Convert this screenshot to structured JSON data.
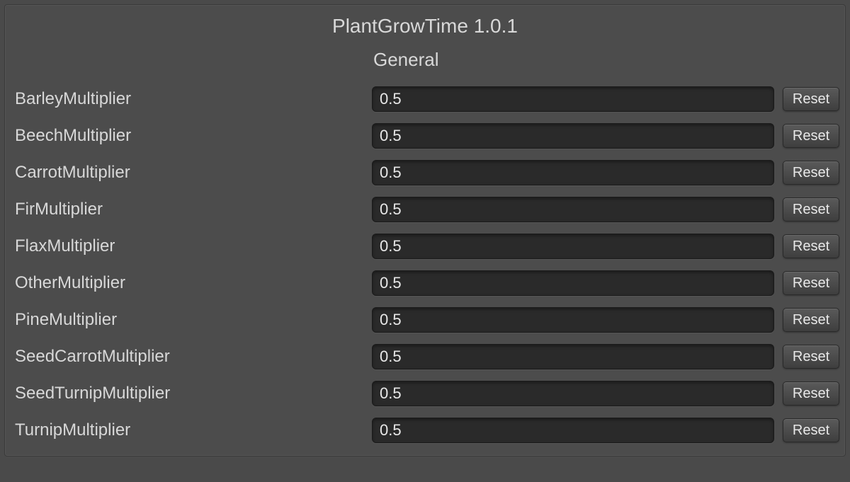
{
  "title": "PlantGrowTime 1.0.1",
  "section": "General",
  "reset_label": "Reset",
  "settings": [
    {
      "label": "BarleyMultiplier",
      "value": "0.5"
    },
    {
      "label": "BeechMultiplier",
      "value": "0.5"
    },
    {
      "label": "CarrotMultiplier",
      "value": "0.5"
    },
    {
      "label": "FirMultiplier",
      "value": "0.5"
    },
    {
      "label": "FlaxMultiplier",
      "value": "0.5"
    },
    {
      "label": "OtherMultiplier",
      "value": "0.5"
    },
    {
      "label": "PineMultiplier",
      "value": "0.5"
    },
    {
      "label": "SeedCarrotMultiplier",
      "value": "0.5"
    },
    {
      "label": "SeedTurnipMultiplier",
      "value": "0.5"
    },
    {
      "label": "TurnipMultiplier",
      "value": "0.5"
    }
  ]
}
